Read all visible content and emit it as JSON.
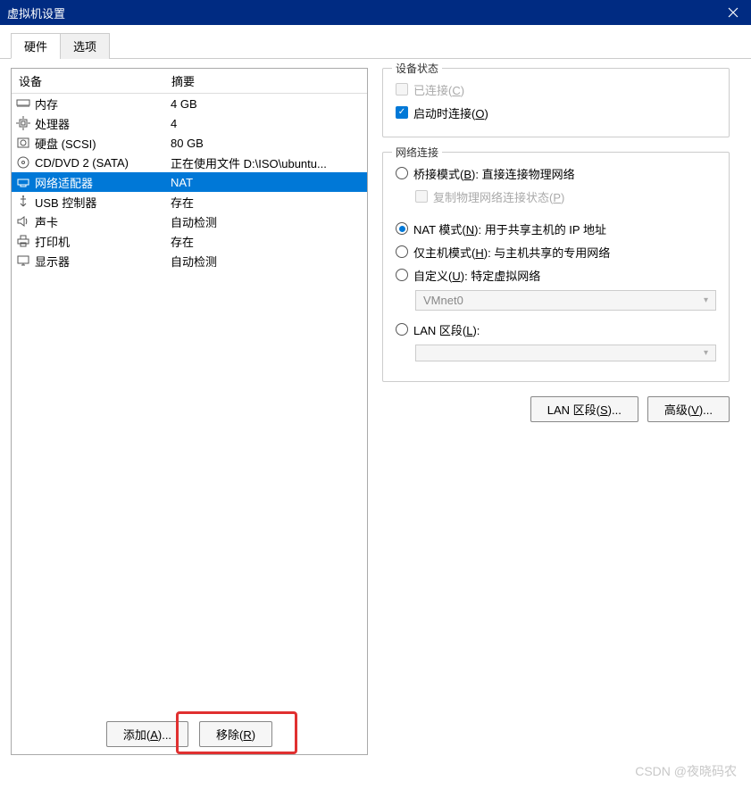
{
  "title": "虚拟机设置",
  "tabs": {
    "hardware": "硬件",
    "options": "选项"
  },
  "table": {
    "device_header": "设备",
    "summary_header": "摘要"
  },
  "devices": [
    {
      "name": "内存",
      "summary": "4 GB",
      "icon": "memory"
    },
    {
      "name": "处理器",
      "summary": "4",
      "icon": "cpu"
    },
    {
      "name": "硬盘 (SCSI)",
      "summary": "80 GB",
      "icon": "hdd"
    },
    {
      "name": "CD/DVD 2 (SATA)",
      "summary": "正在使用文件 D:\\ISO\\ubuntu...",
      "icon": "cd"
    },
    {
      "name": "网络适配器",
      "summary": "NAT",
      "icon": "net",
      "selected": true
    },
    {
      "name": "USB 控制器",
      "summary": "存在",
      "icon": "usb"
    },
    {
      "name": "声卡",
      "summary": "自动检测",
      "icon": "sound"
    },
    {
      "name": "打印机",
      "summary": "存在",
      "icon": "printer"
    },
    {
      "name": "显示器",
      "summary": "自动检测",
      "icon": "display"
    }
  ],
  "device_status": {
    "title": "设备状态",
    "connected_pre": "已连接(",
    "connected_key": "C",
    "connected_post": ")",
    "startup_pre": "启动时连接(",
    "startup_key": "O",
    "startup_post": ")"
  },
  "net_conn": {
    "title": "网络连接",
    "bridge_pre": "桥接模式(",
    "bridge_key": "B",
    "bridge_post": "): 直接连接物理网络",
    "copy_pre": "复制物理网络连接状态(",
    "copy_key": "P",
    "copy_post": ")",
    "nat_pre": "NAT 模式(",
    "nat_key": "N",
    "nat_post": "): 用于共享主机的 IP 地址",
    "host_pre": "仅主机模式(",
    "host_key": "H",
    "host_post": "): 与主机共享的专用网络",
    "custom_pre": "自定义(",
    "custom_key": "U",
    "custom_post": "): 特定虚拟网络",
    "custom_value": "VMnet0",
    "lan_pre": "LAN 区段(",
    "lan_key": "L",
    "lan_post": "):",
    "lan_value": ""
  },
  "buttons": {
    "add_pre": "添加(",
    "add_key": "A",
    "add_post": ")...",
    "remove_pre": "移除(",
    "remove_key": "R",
    "remove_post": ")",
    "lan_seg_pre": "LAN 区段(",
    "lan_seg_key": "S",
    "lan_seg_post": ")...",
    "advanced_pre": "高级(",
    "advanced_key": "V",
    "advanced_post": ")..."
  },
  "watermark": "CSDN @夜晓码农"
}
